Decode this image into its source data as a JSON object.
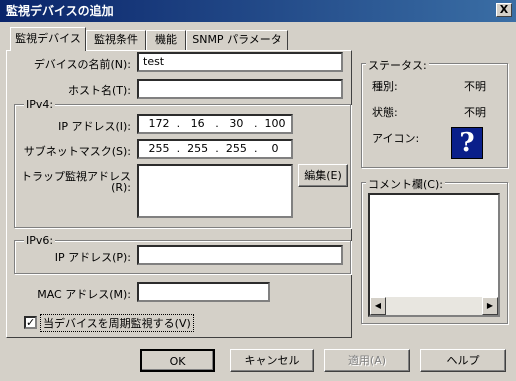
{
  "window": {
    "title": "監視デバイスの追加",
    "close_glyph": "X"
  },
  "tabs": [
    {
      "label": "監視デバイス",
      "active": true
    },
    {
      "label": "監視条件",
      "active": false
    },
    {
      "label": "機能",
      "active": false
    },
    {
      "label": "SNMP パラメーター",
      "active": false
    }
  ],
  "form": {
    "device_name_label": "デバイスの名前(N):",
    "device_name_value": "test",
    "host_name_label": "ホスト名(T):",
    "host_name_value": "",
    "ipv4_group": "IPv4:",
    "ip_address_label": "IP アドレス(I):",
    "ip_address": [
      "172",
      "16",
      "30",
      "100"
    ],
    "subnet_label": "サブネットマスク(S):",
    "subnet": [
      "255",
      "255",
      "255",
      "0"
    ],
    "trap_label_1": "トラップ監視アドレス",
    "trap_label_2": "(R):",
    "edit_button": "編集(E)",
    "ipv6_group": "IPv6:",
    "ipv6_address_label": "IP アドレス(P):",
    "ipv6_address_value": "",
    "mac_label": "MAC アドレス(M):",
    "mac_value": "",
    "periodic_monitor_label": "当デバイスを周期監視する(V)",
    "periodic_monitor_checked": true,
    "check_glyph": "✓",
    "ip_separator": "."
  },
  "status": {
    "group": "ステータス:",
    "type_label": "種別:",
    "type_value": "不明",
    "state_label": "状態:",
    "state_value": "不明",
    "icon_label": "アイコン:",
    "icon_glyph": "?"
  },
  "comment": {
    "group": "コメント欄(C):",
    "value": ""
  },
  "buttons": {
    "ok": "OK",
    "cancel": "キャンセル",
    "apply": "適用(A)",
    "help": "ヘルプ"
  },
  "colors": {
    "titlebar_start": "#0a246a",
    "titlebar_end": "#3a6ea5",
    "face": "#d4d0c8",
    "icon_bg": "#0a1f8a"
  }
}
